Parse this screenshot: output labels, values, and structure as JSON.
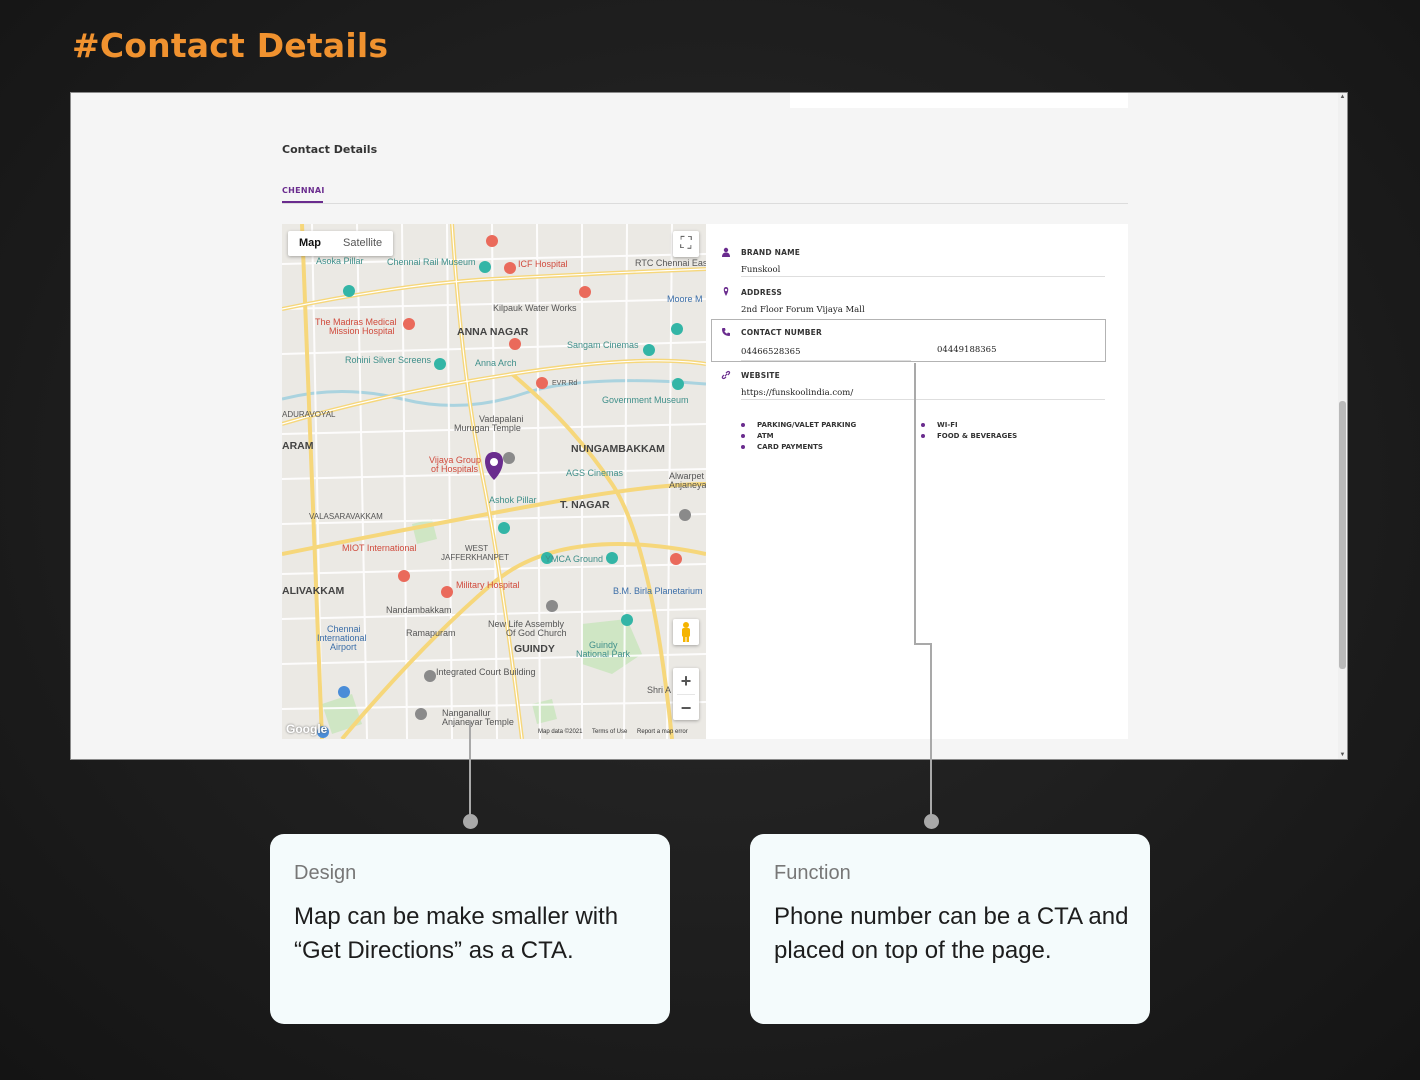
{
  "page": {
    "heading": "#Contact Details"
  },
  "screen": {
    "section_title": "Contact Details",
    "tab": "CHENNAI",
    "map": {
      "type_map": "Map",
      "type_satellite": "Satellite",
      "zoom_in": "+",
      "zoom_out": "−",
      "footer": {
        "data": "Map data ©2021",
        "terms": "Terms of Use",
        "report": "Report a map error"
      },
      "logo": "Google",
      "labels": [
        "Asoka Pillar",
        "Chennai Rail Museum",
        "ICF Hospital",
        "RTC Chennai Eas",
        "Kilpauk Water Works",
        "Moore M",
        "The Madras Medical",
        "Mission Hospital",
        "ANNA NAGAR",
        "Sangam Cinemas",
        "Rohini Silver Screens",
        "Anna Arch",
        "EVR Rd",
        "Government Museum",
        "ADURAVOYAL",
        "Vadapalani",
        "Murugan Temple",
        "ARAM",
        "NUNGAMBAKKAM",
        "Vijaya Group",
        "of Hospitals",
        "AGS Cinemas",
        "Alwarpet",
        "Anjaneya",
        "Ashok Pillar",
        "T. NAGAR",
        "VALASARAVAKKAM",
        "MIOT International",
        "WEST",
        "JAFFERKHANPET",
        "YMCA Ground",
        "ALIVAKKAM",
        "Military Hospital",
        "B.M. Birla Planetarium",
        "Nandambakkam",
        "Chennai",
        "International",
        "Airport",
        "Ramapuram",
        "New Life Assembly",
        "Of God Church",
        "GUINDY",
        "Guindy",
        "National Park",
        "Integrated Court Building",
        "Shri A",
        "Nanganallur",
        "Anjaneyar Temple"
      ]
    },
    "info": {
      "brand_label": "BRAND NAME",
      "brand_value": "Funskool",
      "address_label": "ADDRESS",
      "address_value": "2nd Floor Forum Vijaya Mall",
      "contact_label": "CONTACT NUMBER",
      "phone1": "04466528365",
      "phone2": "04449188365",
      "website_label": "WEBSITE",
      "website_value": "https://funskoolindia.com/",
      "amenities_left": [
        "PARKING/VALET PARKING",
        "ATM",
        "CARD PAYMENTS"
      ],
      "amenities_right": [
        "WI-FI",
        "FOOD & BEVERAGES"
      ]
    }
  },
  "cards": [
    {
      "kicker": "Design",
      "body": "Map can be make smaller with “Get Directions” as a CTA."
    },
    {
      "kicker": "Function",
      "body": "Phone number can be a CTA and placed on top of the page."
    }
  ],
  "colors": {
    "accent": "#f0922f",
    "brand_purple": "#6a2c8e",
    "card_bg": "#f4fbfc"
  }
}
